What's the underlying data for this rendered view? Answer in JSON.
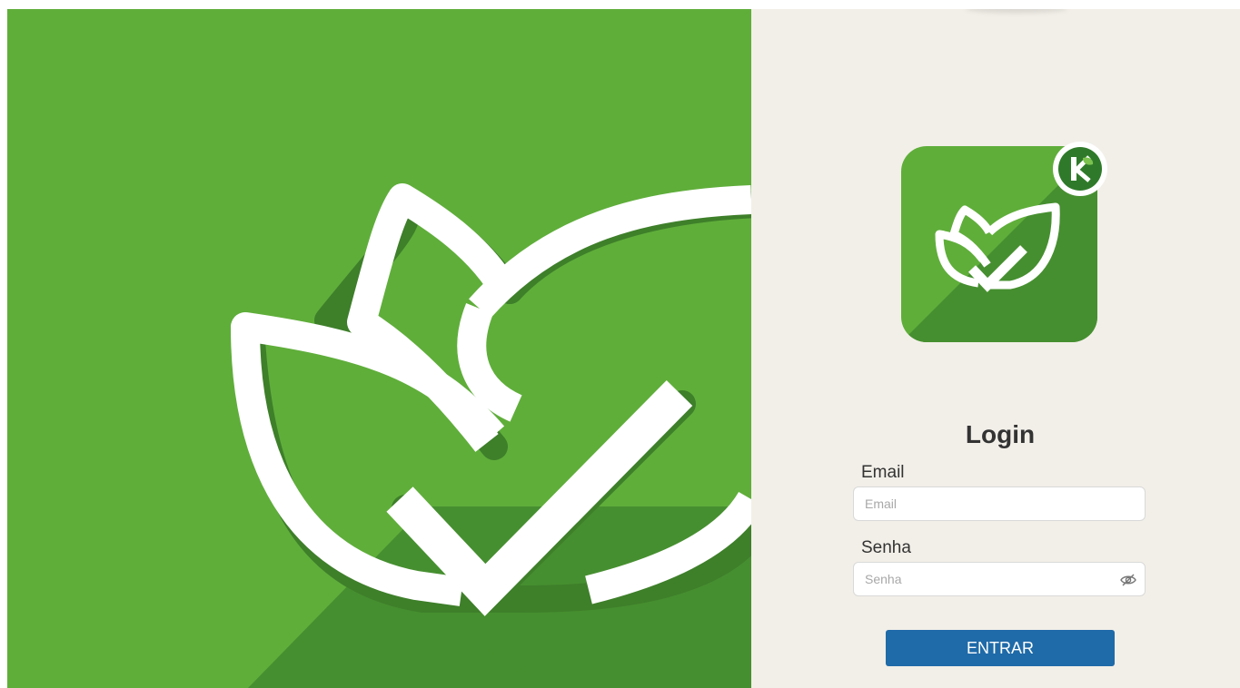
{
  "login": {
    "title": "Login",
    "email_label": "Email",
    "email_placeholder": "Email",
    "email_value": "",
    "password_label": "Senha",
    "password_placeholder": "Senha",
    "password_value": "",
    "submit_label": "ENTRAR"
  },
  "icons": {
    "hero": "leaf-check-icon",
    "app_logo": "leaf-check-icon",
    "badge": "k-leaf-badge-icon",
    "password_toggle": "eye-slash-icon"
  },
  "colors": {
    "brand_green": "#5fae3a",
    "brand_green_dark": "#468f30",
    "panel_background": "#f2efe8",
    "button": "#1f6aa8"
  }
}
